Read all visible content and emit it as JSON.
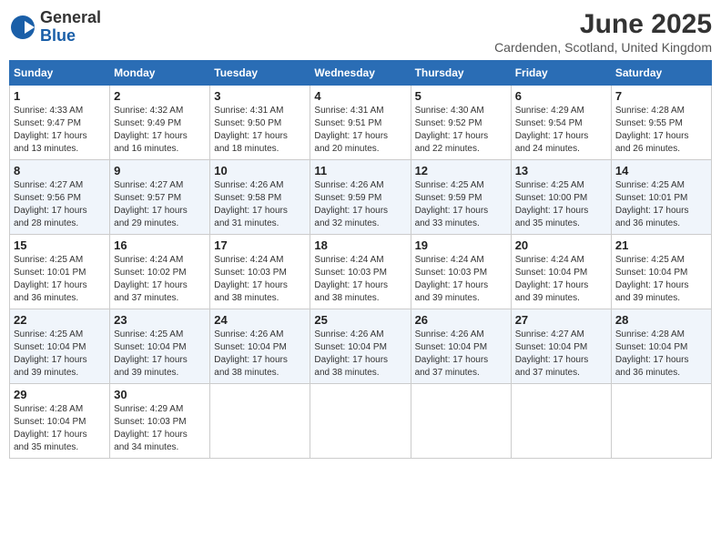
{
  "header": {
    "logo_general": "General",
    "logo_blue": "Blue",
    "month_title": "June 2025",
    "location": "Cardenden, Scotland, United Kingdom"
  },
  "days_of_week": [
    "Sunday",
    "Monday",
    "Tuesday",
    "Wednesday",
    "Thursday",
    "Friday",
    "Saturday"
  ],
  "weeks": [
    [
      {
        "day": 1,
        "info": "Sunrise: 4:33 AM\nSunset: 9:47 PM\nDaylight: 17 hours\nand 13 minutes."
      },
      {
        "day": 2,
        "info": "Sunrise: 4:32 AM\nSunset: 9:49 PM\nDaylight: 17 hours\nand 16 minutes."
      },
      {
        "day": 3,
        "info": "Sunrise: 4:31 AM\nSunset: 9:50 PM\nDaylight: 17 hours\nand 18 minutes."
      },
      {
        "day": 4,
        "info": "Sunrise: 4:31 AM\nSunset: 9:51 PM\nDaylight: 17 hours\nand 20 minutes."
      },
      {
        "day": 5,
        "info": "Sunrise: 4:30 AM\nSunset: 9:52 PM\nDaylight: 17 hours\nand 22 minutes."
      },
      {
        "day": 6,
        "info": "Sunrise: 4:29 AM\nSunset: 9:54 PM\nDaylight: 17 hours\nand 24 minutes."
      },
      {
        "day": 7,
        "info": "Sunrise: 4:28 AM\nSunset: 9:55 PM\nDaylight: 17 hours\nand 26 minutes."
      }
    ],
    [
      {
        "day": 8,
        "info": "Sunrise: 4:27 AM\nSunset: 9:56 PM\nDaylight: 17 hours\nand 28 minutes."
      },
      {
        "day": 9,
        "info": "Sunrise: 4:27 AM\nSunset: 9:57 PM\nDaylight: 17 hours\nand 29 minutes."
      },
      {
        "day": 10,
        "info": "Sunrise: 4:26 AM\nSunset: 9:58 PM\nDaylight: 17 hours\nand 31 minutes."
      },
      {
        "day": 11,
        "info": "Sunrise: 4:26 AM\nSunset: 9:59 PM\nDaylight: 17 hours\nand 32 minutes."
      },
      {
        "day": 12,
        "info": "Sunrise: 4:25 AM\nSunset: 9:59 PM\nDaylight: 17 hours\nand 33 minutes."
      },
      {
        "day": 13,
        "info": "Sunrise: 4:25 AM\nSunset: 10:00 PM\nDaylight: 17 hours\nand 35 minutes."
      },
      {
        "day": 14,
        "info": "Sunrise: 4:25 AM\nSunset: 10:01 PM\nDaylight: 17 hours\nand 36 minutes."
      }
    ],
    [
      {
        "day": 15,
        "info": "Sunrise: 4:25 AM\nSunset: 10:01 PM\nDaylight: 17 hours\nand 36 minutes."
      },
      {
        "day": 16,
        "info": "Sunrise: 4:24 AM\nSunset: 10:02 PM\nDaylight: 17 hours\nand 37 minutes."
      },
      {
        "day": 17,
        "info": "Sunrise: 4:24 AM\nSunset: 10:03 PM\nDaylight: 17 hours\nand 38 minutes."
      },
      {
        "day": 18,
        "info": "Sunrise: 4:24 AM\nSunset: 10:03 PM\nDaylight: 17 hours\nand 38 minutes."
      },
      {
        "day": 19,
        "info": "Sunrise: 4:24 AM\nSunset: 10:03 PM\nDaylight: 17 hours\nand 39 minutes."
      },
      {
        "day": 20,
        "info": "Sunrise: 4:24 AM\nSunset: 10:04 PM\nDaylight: 17 hours\nand 39 minutes."
      },
      {
        "day": 21,
        "info": "Sunrise: 4:25 AM\nSunset: 10:04 PM\nDaylight: 17 hours\nand 39 minutes."
      }
    ],
    [
      {
        "day": 22,
        "info": "Sunrise: 4:25 AM\nSunset: 10:04 PM\nDaylight: 17 hours\nand 39 minutes."
      },
      {
        "day": 23,
        "info": "Sunrise: 4:25 AM\nSunset: 10:04 PM\nDaylight: 17 hours\nand 39 minutes."
      },
      {
        "day": 24,
        "info": "Sunrise: 4:26 AM\nSunset: 10:04 PM\nDaylight: 17 hours\nand 38 minutes."
      },
      {
        "day": 25,
        "info": "Sunrise: 4:26 AM\nSunset: 10:04 PM\nDaylight: 17 hours\nand 38 minutes."
      },
      {
        "day": 26,
        "info": "Sunrise: 4:26 AM\nSunset: 10:04 PM\nDaylight: 17 hours\nand 37 minutes."
      },
      {
        "day": 27,
        "info": "Sunrise: 4:27 AM\nSunset: 10:04 PM\nDaylight: 17 hours\nand 37 minutes."
      },
      {
        "day": 28,
        "info": "Sunrise: 4:28 AM\nSunset: 10:04 PM\nDaylight: 17 hours\nand 36 minutes."
      }
    ],
    [
      {
        "day": 29,
        "info": "Sunrise: 4:28 AM\nSunset: 10:04 PM\nDaylight: 17 hours\nand 35 minutes."
      },
      {
        "day": 30,
        "info": "Sunrise: 4:29 AM\nSunset: 10:03 PM\nDaylight: 17 hours\nand 34 minutes."
      },
      null,
      null,
      null,
      null,
      null
    ]
  ]
}
